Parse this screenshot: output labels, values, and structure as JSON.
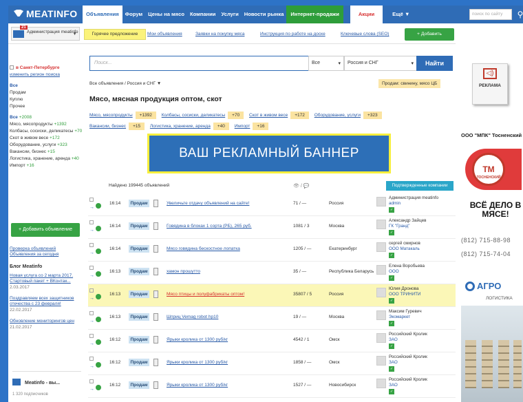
{
  "topbar": {
    "logo": "MEATINFO",
    "nav": [
      "Объявления",
      "Форум",
      "Цены на мясо",
      "Компании",
      "Услуги",
      "Новости рынка",
      "Интернет-продажи",
      "Акции",
      "Ещё ▼"
    ],
    "search_placeholder": "поиск по сайту",
    "search_icon": "magnifier-icon"
  },
  "subbar": {
    "account_name": "Администрация meatinfo",
    "account_badge": "21",
    "hot": "Горячее предложение",
    "links": [
      "Мои объявления",
      "Заявки на покупку мяса",
      "Инструкция по работе на доске",
      "Ключевые слова (SEO)"
    ],
    "add_button": "+ Добавить объявление"
  },
  "sidebar": {
    "region": "в Санкт-Петербурге",
    "change_region": "изменить регион поиска",
    "all": "Все",
    "kinds": [
      "Продам",
      "Куплю",
      "Прочее"
    ],
    "all_count_label": "Все",
    "all_count": "+2008",
    "categories": [
      {
        "name": "Мясо, мясопродукты",
        "count": "+1392"
      },
      {
        "name": "Колбасы, сосиски, деликатесы",
        "count": "+70"
      },
      {
        "name": "Скот в живом весе",
        "count": "+172"
      },
      {
        "name": "Оборудование, услуги",
        "count": "+323"
      },
      {
        "name": "Вакансии, бизнес",
        "count": "+15"
      },
      {
        "name": "Логистика, хранение, аренда",
        "count": "+40"
      },
      {
        "name": "Импорт",
        "count": "+16"
      }
    ],
    "add_button": "+ Добавить объявление",
    "links": [
      "Проверка объявлений",
      "Объявления за сегодня"
    ],
    "blog_title": "Блог Meatinfo",
    "blog": [
      {
        "title": "Новая услуга со 2 марта 2017. Стартовый пакет + ВКонтак...",
        "date": "2.03.2017"
      },
      {
        "title": "Поздравляем всех защитников отечества с 23 февраля!",
        "date": "22.02.2017"
      },
      {
        "title": "Обновление мониторингов цен",
        "date": "21.02.2017"
      }
    ],
    "fb": "Meatinfo - вы...",
    "fb_sub": "1 320 подписчиков"
  },
  "search": {
    "placeholder": "Поиск...",
    "type": "Все",
    "region": "Россия и СНГ",
    "button": "Найти"
  },
  "breadcrumbs": "Все объявления / Россия и СНГ ▼",
  "tag_hint": "Продам: свинину, мясо ЦБ",
  "heading": "Мясо, мясная продукция оптом, скот",
  "cats": [
    {
      "name": "Мясо, мясопродукты",
      "count": "+1392"
    },
    {
      "name": "Колбасы, сосиски, деликатесы",
      "count": "+70"
    },
    {
      "name": "Скот в живом весе",
      "count": "+172"
    },
    {
      "name": "Оборудование, услуги",
      "count": "+323"
    },
    {
      "name": "Вакансии, бизнес",
      "count": "+15"
    },
    {
      "name": "Логистика, хранение, аренда",
      "count": "+40"
    },
    {
      "name": "Импорт",
      "count": "+16"
    }
  ],
  "banner": "ВАШ РЕКЛАМНЫЙ БАННЕР",
  "found": "Найдено 199445 объявлений",
  "views_hdr": "👁 / 💬",
  "premium": "Подтвержденные компании",
  "rows": [
    {
      "time": "16:14",
      "type": "Продам",
      "title": "Увеличьте отдачу объявлений на сайте!",
      "views": "71 / —",
      "city": "Россия",
      "seller1": "Администрация meatinfo",
      "seller2": "admin",
      "hl": false
    },
    {
      "time": "16:14",
      "type": "Продам",
      "title": "Говядина в блоках 1 сорта (РБ), 265 руб.",
      "views": "1081 / 3",
      "city": "Москва",
      "seller1": "Александр Зайцев",
      "seller2": "ГК \"Гранд\"",
      "hl": false
    },
    {
      "time": "16:14",
      "type": "Продам",
      "title": "Мясо говядина бескостное лопатка",
      "views": "1205 / —",
      "city": "Екатеринбург",
      "seller1": "сергей смирнов",
      "seller2": "ООО Матакаль",
      "hl": false
    },
    {
      "time": "16:13",
      "type": "Продам",
      "title": "хамон прошутто",
      "views": "35 / —",
      "city": "Республика Беларусь",
      "seller1": "Елена Воробьева",
      "seller2": "ООО",
      "hl": false
    },
    {
      "time": "16:13",
      "type": "Продам",
      "title": "Мясо птицы и полуфабрикаты оптом!",
      "views": "35807 / 5",
      "city": "Россия",
      "seller1": "Юлия Дронова",
      "seller2": "ООО ТРИНИТИ",
      "hl": true
    },
    {
      "time": "16:13",
      "type": "Продам",
      "title": "Шприц Vemag robot hp10",
      "views": "19 / —",
      "city": "Москва",
      "seller1": "Максим Гуревич",
      "seller2": "Экомаркет",
      "hl": false
    },
    {
      "time": "16:12",
      "type": "Продам",
      "title": "Ярыки кролика от 1300 руб/кг",
      "views": "4542 / 1",
      "city": "Омск",
      "seller1": "Российский Кролик",
      "seller2": "ЗАО",
      "hl": false
    },
    {
      "time": "16:12",
      "type": "Продам",
      "title": "Ярыки кролика от 1300 руб/кг",
      "views": "1858 / —",
      "city": "Омск",
      "seller1": "Российский Кролик",
      "seller2": "ЗАО",
      "hl": false
    },
    {
      "time": "16:12",
      "type": "Продам",
      "title": "Ярыки кролика от 1300 руб/кг",
      "views": "1527 / —",
      "city": "Новосибирск",
      "seller1": "Российский Кролик",
      "seller2": "ЗАО",
      "hl": false
    }
  ],
  "ads": {
    "book": "РЕКЛАМА",
    "mpk_head": "ООО \"МПК\" Тосненский",
    "seal": "ТОСНЕНСКИЙ",
    "slogan": "ВСЁ ДЕЛО В МЯСЕ!",
    "phone1": "(812) 715-88-98",
    "phone2": "(812) 715-74-04",
    "agro": "АГРО",
    "agro_sub": "ЛОГИСТИКА"
  },
  "colors": {
    "brand": "#2f6cb6",
    "green": "#37a344",
    "highlight": "#fbf7b7"
  }
}
